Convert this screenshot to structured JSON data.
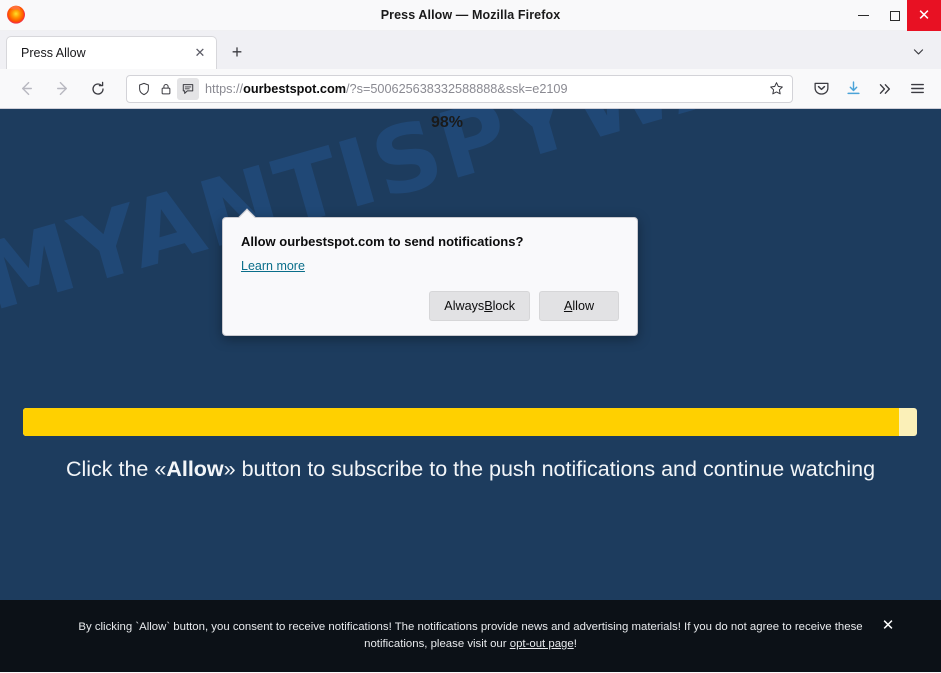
{
  "window": {
    "title": "Press Allow — Mozilla Firefox",
    "minimize_label": "—",
    "maximize_label": "",
    "close_label": "✕"
  },
  "tabs": {
    "items": [
      {
        "label": "Press Allow",
        "close_label": "✕"
      }
    ],
    "new_tab_label": "+",
    "list_all_tabs_label": "⌄"
  },
  "toolbar": {
    "back_label": "←",
    "forward_label": "→",
    "reload_label": "⟳",
    "shield_icon": "shield-icon",
    "lock_icon": "lock-icon",
    "permission_icon": "notification-permission-icon",
    "bookmark_label": "☆",
    "pocket_label": "pocket-icon",
    "downloads_label": "download-icon",
    "overflow_label": "»",
    "menu_label": "≡"
  },
  "urlbar": {
    "scheme": "https://",
    "domain": "ourbestspot.com",
    "path": "/?s=500625638332588888&ssk=e2109",
    "full": "https://ourbestspot.com/?s=500625638332588888&ssk=e2109"
  },
  "permission_popup": {
    "title": "Allow ourbestspot.com to send notifications?",
    "learn_more": "Learn more",
    "block_label_pre": "Always ",
    "block_label_key": "B",
    "block_label_post": "lock",
    "allow_label_key": "A",
    "allow_label_post": "llow"
  },
  "page": {
    "watermark": "MYANTISPYWARE.COM",
    "progress": {
      "percent": 98,
      "label": "98%",
      "fill_color": "#ffd000",
      "track_color": "#fbf0b8"
    },
    "message_pre": "Click the «",
    "message_bold": "Allow",
    "message_post": "» button to subscribe to the push notifications and continue watching",
    "background_color": "#1d3c5e"
  },
  "consent_bar": {
    "text_pre": "By clicking `Allow` button, you consent to receive notifications! The notifications provide news and advertising materials! If you do not agree to receive these notifications, please visit our ",
    "link_label": "opt-out page",
    "text_post": "!",
    "close_label": "✕",
    "background_color": "#0c1117"
  }
}
